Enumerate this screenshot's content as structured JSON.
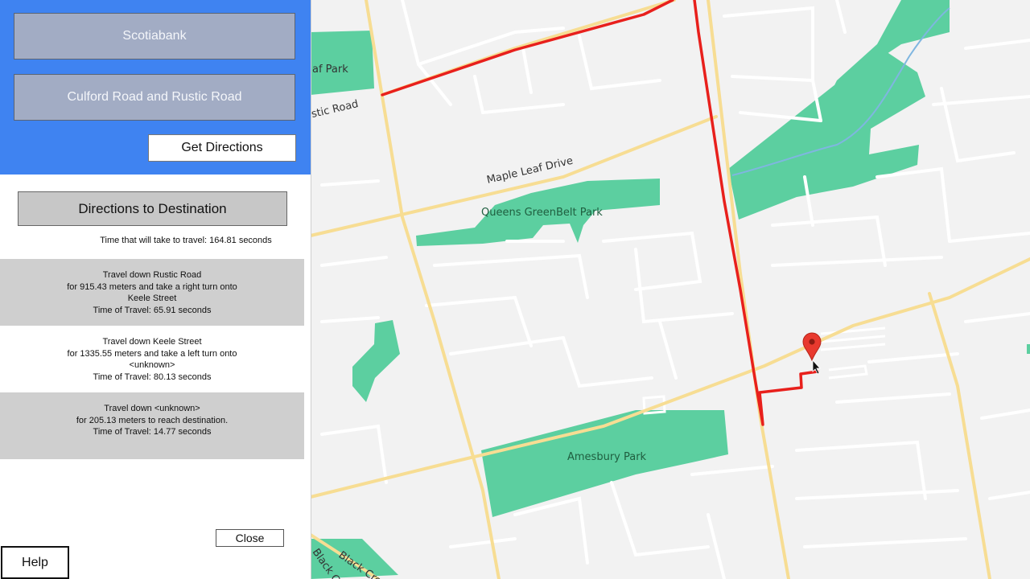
{
  "search": {
    "start_value": "Scotiabank",
    "destination_value": "Culford Road and Rustic Road",
    "get_directions_label": "Get Directions"
  },
  "directions": {
    "header": "Directions to Destination",
    "total_time": "Time that will take to travel: 164.81 seconds",
    "steps": [
      {
        "line1": "Travel down Rustic Road",
        "line2": "for 915.43 meters and take a right turn onto",
        "line3": "Keele Street",
        "line4": "Time of Travel: 65.91 seconds"
      },
      {
        "line1": "Travel down Keele Street",
        "line2": "for 1335.55 meters and take a left turn onto",
        "line3": "<unknown>",
        "line4": "Time of Travel: 80.13 seconds"
      },
      {
        "line1": "Travel down <unknown>",
        "line2": "for 205.13 meters to reach destination.",
        "line3": "Time of Travel: 14.77 seconds",
        "line4": ""
      }
    ]
  },
  "buttons": {
    "close_label": "Close",
    "help_label": "Help"
  },
  "map": {
    "labels": {
      "leaf_park": "af Park",
      "rustic_road": "ustic Road",
      "maple_leaf_drive": "Maple Leaf Drive",
      "queens_greenbelt_park": "Queens GreenBelt Park",
      "amesbury_park": "Amesbury Park",
      "black_creek_1": "Black Creek",
      "black_creek_2": "Black Cre"
    },
    "colors": {
      "background": "#f2f2f2",
      "park": "#5ccfa0",
      "arterial": "#f7dd93",
      "route": "#e8201c",
      "marker": "#e8392e",
      "panel_blue": "#3f83f1"
    }
  }
}
